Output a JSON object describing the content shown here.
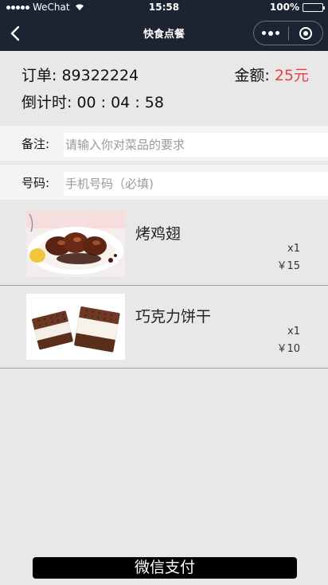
{
  "status_bar": {
    "carrier": "WeChat",
    "time": "15:58",
    "battery": "100%"
  },
  "nav": {
    "title": "快食点餐"
  },
  "order": {
    "number_label": "订单: 89322224",
    "amount_label": "金额: ",
    "amount_value": "25元",
    "countdown_label": "倒计时: 00 : 04 : 58"
  },
  "fields": {
    "note": {
      "label": "备注:",
      "placeholder": "请输入你对菜品的要求",
      "value": ""
    },
    "phone": {
      "label": "号码:",
      "placeholder": "手机号码（必填)",
      "value": ""
    }
  },
  "items": [
    {
      "name": "烤鸡翅",
      "qty": "x1",
      "price": "￥15",
      "icon": "roast-chicken-wings-photo"
    },
    {
      "name": "巧克力饼干",
      "qty": "x1",
      "price": "￥10",
      "icon": "chocolate-cookie-sandwich-photo"
    }
  ],
  "pay": {
    "label": "微信支付"
  },
  "colors": {
    "nav_bg": "#1c2331",
    "page_bg": "#e8e8e8",
    "amount": "#e64340",
    "pay_button": "#000000"
  }
}
